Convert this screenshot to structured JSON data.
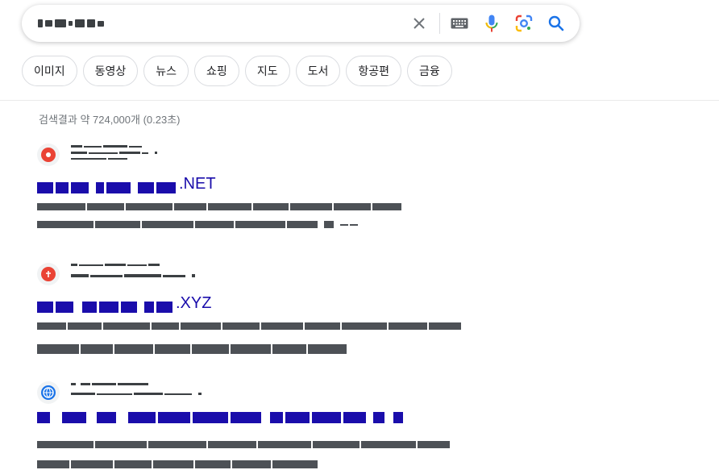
{
  "search": {
    "value": "",
    "placeholder": ""
  },
  "icons": {
    "clear": "close-icon",
    "keyboard": "keyboard-icon",
    "voice": "microphone-icon",
    "lens": "lens-icon",
    "search": "search-icon"
  },
  "chips": [
    "이미지",
    "동영상",
    "뉴스",
    "쇼핑",
    "지도",
    "도서",
    "항공편",
    "금융"
  ],
  "stats": "검색결과 약 724,000개 (0.23초)",
  "results": [
    {
      "title_suffix": ".NET",
      "favicon_color": "#ea4335"
    },
    {
      "title_suffix": ".XYZ",
      "favicon_color": "#ea4335"
    },
    {
      "title_suffix": "",
      "favicon_color": "#1a73e8"
    }
  ],
  "colors": {
    "link": "#1a0dab",
    "snippet": "#4d5156",
    "stats": "#70757a",
    "mic_blue": "#4285f4",
    "mic_red": "#ea4335",
    "search_blue": "#1a73e8"
  }
}
